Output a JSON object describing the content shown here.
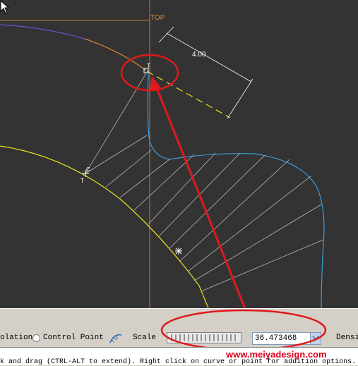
{
  "viewport": {
    "view_name": "TOP",
    "dimension_value": "4.00",
    "background": "#333333"
  },
  "toolbar": {
    "interpolation_label": "olation",
    "control_point_label": "Control Point",
    "scale_label": "Scale",
    "scale_value": "36.473468",
    "density_label": "Densi"
  },
  "status": {
    "message": "k and drag (CTRL-ALT to extend). Right click on curve or point for addition options."
  },
  "watermark": "www.meiyadesign.com",
  "annotation": {
    "color": "#e0191b"
  }
}
